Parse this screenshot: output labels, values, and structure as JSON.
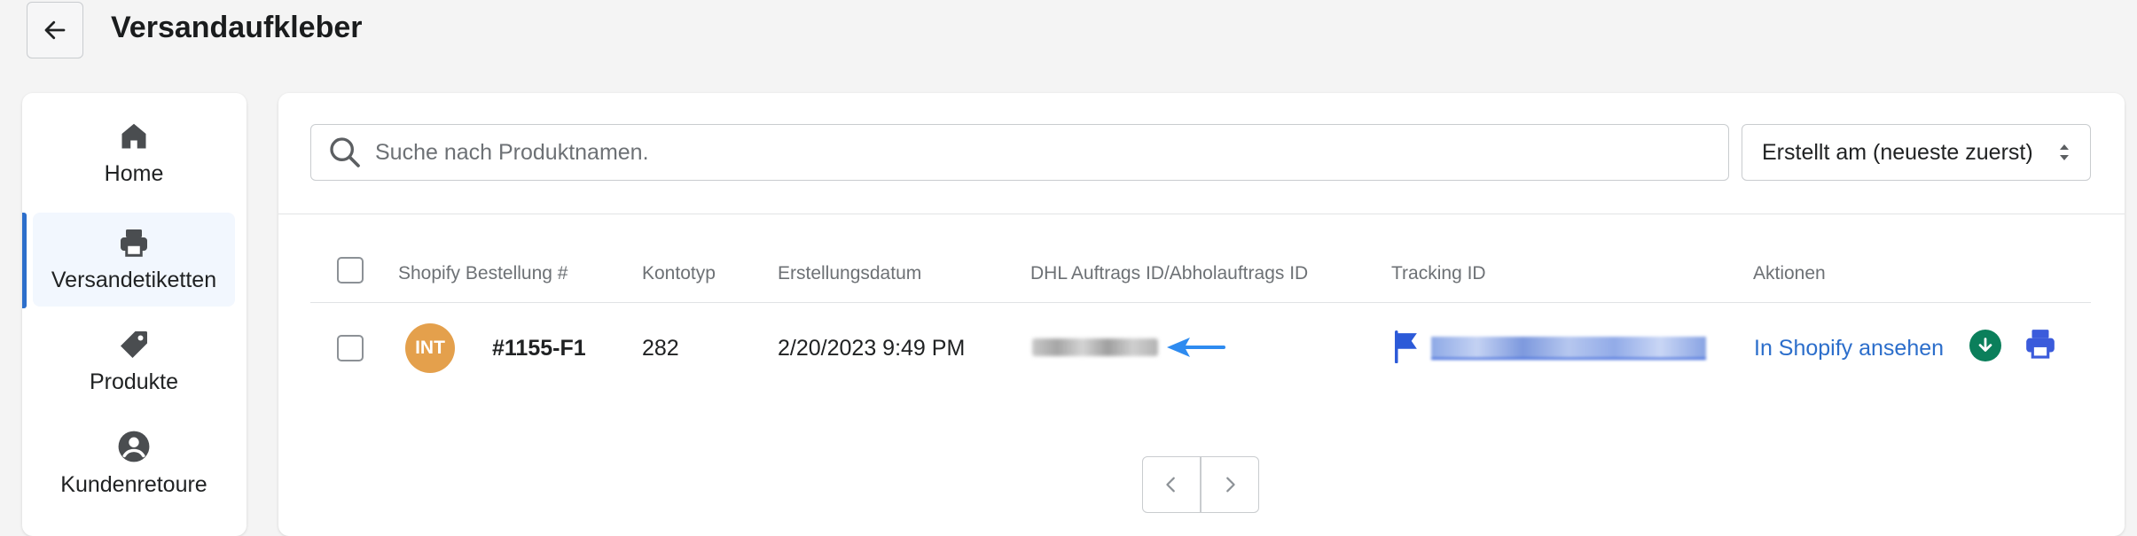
{
  "header": {
    "title": "Versandaufkleber"
  },
  "sidebar": {
    "items": [
      {
        "label": "Home",
        "icon": "home-icon",
        "active": false
      },
      {
        "label": "Versandetiketten",
        "icon": "printer-icon",
        "active": true
      },
      {
        "label": "Produkte",
        "icon": "tag-icon",
        "active": false
      },
      {
        "label": "Kundenretoure",
        "icon": "user-circle-icon",
        "active": false
      }
    ]
  },
  "search": {
    "placeholder": "Suche nach Produktnamen.",
    "value": ""
  },
  "sort": {
    "selected": "Erstellt am (neueste zuerst)"
  },
  "table": {
    "columns": [
      "Shopify Bestellung #",
      "Kontotyp",
      "Erstellungsdatum",
      "DHL Auftrags ID/Abholauftrags ID",
      "Tracking ID",
      "Aktionen"
    ],
    "rows": [
      {
        "avatar": "INT",
        "order": "#1155-F1",
        "account_type": "282",
        "created": "2/20/2023 9:49 PM",
        "dhl_id_redacted": true,
        "tracking_redacted": true,
        "action_link": "In Shopify ansehen"
      }
    ]
  },
  "colors": {
    "accent": "#2c6ecb",
    "avatar": "#e4a04c",
    "download": "#0b7f5b",
    "print": "#3b5bdb",
    "arrow": "#2e8bf0"
  }
}
